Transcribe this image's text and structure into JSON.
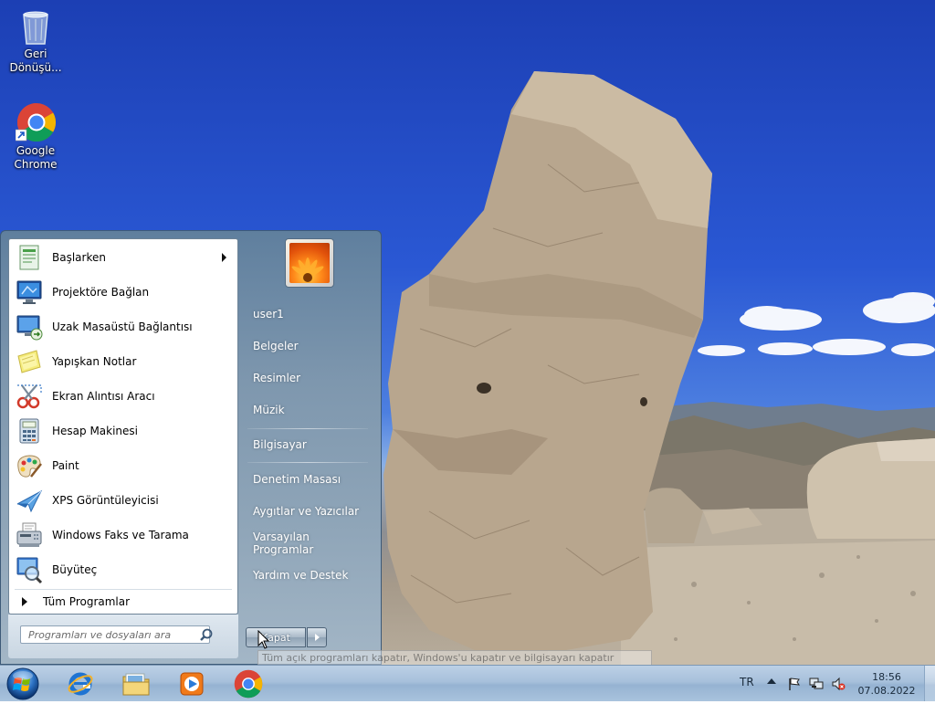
{
  "desktop": {
    "icons": [
      {
        "label_line1": "Geri",
        "label_line2": "Dönüşü...",
        "icon": "recycle-bin-icon"
      },
      {
        "label_line1": "Google",
        "label_line2": "Chrome",
        "icon": "chrome-icon"
      }
    ]
  },
  "start_menu": {
    "programs": [
      {
        "label": "Başlarken",
        "icon": "getting-started-icon",
        "has_submenu": true
      },
      {
        "label": "Projektöre Bağlan",
        "icon": "projector-icon"
      },
      {
        "label": "Uzak Masaüstü Bağlantısı",
        "icon": "remote-desktop-icon"
      },
      {
        "label": "Yapışkan Notlar",
        "icon": "sticky-notes-icon"
      },
      {
        "label": "Ekran Alıntısı Aracı",
        "icon": "snipping-tool-icon"
      },
      {
        "label": "Hesap Makinesi",
        "icon": "calculator-icon"
      },
      {
        "label": "Paint",
        "icon": "paint-icon"
      },
      {
        "label": "XPS Görüntüleyicisi",
        "icon": "xps-viewer-icon"
      },
      {
        "label": "Windows Faks ve Tarama",
        "icon": "fax-scan-icon"
      },
      {
        "label": "Büyüteç",
        "icon": "magnifier-icon"
      }
    ],
    "all_programs_label": "Tüm Programlar",
    "search_placeholder": "Programları ve dosyaları ara",
    "right_items": [
      {
        "label": "user1"
      },
      {
        "label": "Belgeler"
      },
      {
        "label": "Resimler"
      },
      {
        "label": "Müzik"
      },
      {
        "label": "Bilgisayar"
      },
      {
        "label": "Denetim Masası"
      },
      {
        "label": "Aygıtlar ve Yazıcılar"
      },
      {
        "label": "Varsayılan Programlar"
      },
      {
        "label": "Yardım ve Destek"
      }
    ],
    "shutdown_label": "Kapat",
    "tooltip_text": "Tüm açık programları kapatır, Windows'u kapatır ve bilgisayarı kapatır"
  },
  "taskbar": {
    "apps": [
      {
        "name": "Internet Explorer",
        "icon": "internet-explorer-icon"
      },
      {
        "name": "Windows Explorer",
        "icon": "file-explorer-icon"
      },
      {
        "name": "Windows Media Player",
        "icon": "media-player-icon"
      },
      {
        "name": "Google Chrome",
        "icon": "chrome-icon"
      }
    ],
    "tray": {
      "language": "TR",
      "time": "18:56",
      "date": "07.08.2022"
    }
  },
  "colors": {
    "sky_top": "#1c3fb4",
    "taskbar": "#a7c0db",
    "start_menu_right": "#7e97ae"
  }
}
